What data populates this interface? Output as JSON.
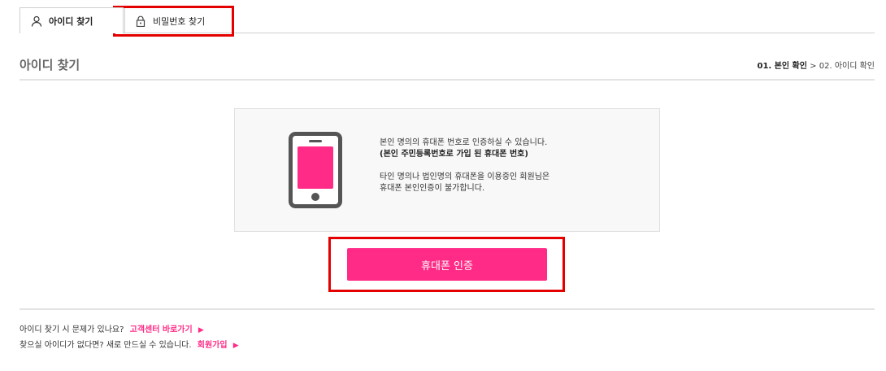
{
  "tabs": {
    "find_id": "아이디 찾기",
    "find_password": "비밀번호 찾기"
  },
  "header": {
    "title": "아이디 찾기",
    "step_current": "01. 본인 확인",
    "step_separator": ">",
    "step_next": "02. 아이디 확인"
  },
  "info": {
    "line1": "본인 명의의 휴대폰 번호로 인증하실 수 있습니다.",
    "line2": "(본인 주민등록번호로 가입 된 휴대폰 번호)",
    "line3": "타인 명의나 법인명의 휴대폰을 이용중인 회원님은",
    "line4": "휴대폰 본인인증이 불가합니다."
  },
  "button": {
    "cert_label": "휴대폰 인증"
  },
  "help": {
    "q1": "아이디 찾기 시 문제가 있나요?",
    "link1": "고객센터 바로가기",
    "q2": "찾으실 아이디가 없다면? 새로 만드실 수 있습니다.",
    "link2": "회원가입",
    "arrow": "▶"
  },
  "colors": {
    "accent": "#ff2b86",
    "highlight": "#e50000",
    "icon_gray": "#555555"
  }
}
